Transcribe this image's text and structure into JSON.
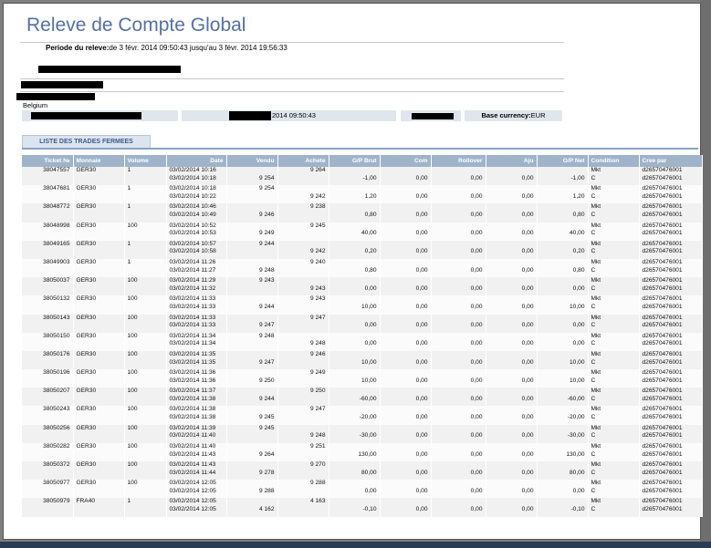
{
  "title": "Releve de Compte Global",
  "period": {
    "label": "Periode du releve:",
    "value": "de 3 févr. 2014 09:50:43 jusqu'au 3 févr. 2014 19:56:33"
  },
  "country": "Belgium",
  "info": {
    "date_suffix": "2014 09:50:43",
    "base_currency_label": "Base currency:",
    "base_currency_value": "EUR"
  },
  "tab_label": "LISTE DES TRADES FERMEES",
  "columns": [
    "Ticket №",
    "Monnaie",
    "Volume",
    "Date",
    "Vendu",
    "Achete",
    "G/P Brut",
    "Com",
    "Rollover",
    "Aju",
    "G/P Net",
    "Condition",
    "Cree par"
  ],
  "trades": [
    {
      "ticket": "38047557",
      "monnaie": "GER30",
      "volume": "1",
      "date1": "03/02/2014 10:16",
      "date2": "03/02/2014 10:18",
      "vendu": "9 254",
      "vendu_row": 2,
      "achete": "9 264",
      "achete_row": 1,
      "gp_brut": "-1,00",
      "com": "0,00",
      "rollover": "0,00",
      "aju": "0,00",
      "gp_net": "-1,00",
      "cond1": "Mkt",
      "cond2": "C",
      "cree1": "d26570476001",
      "cree2": "d26570476001"
    },
    {
      "ticket": "38047681",
      "monnaie": "GER30",
      "volume": "1",
      "date1": "03/02/2014 10:18",
      "date2": "03/02/2014 10:22",
      "vendu": "9 254",
      "vendu_row": 1,
      "achete": "9 242",
      "achete_row": 2,
      "gp_brut": "1,20",
      "com": "0,00",
      "rollover": "0,00",
      "aju": "0,00",
      "gp_net": "1,20",
      "cond1": "Mkt",
      "cond2": "C",
      "cree1": "d26570476001",
      "cree2": "d26570476001"
    },
    {
      "ticket": "38048772",
      "monnaie": "GER30",
      "volume": "1",
      "date1": "03/02/2014 10:46",
      "date2": "03/02/2014 10:49",
      "vendu": "9 246",
      "vendu_row": 2,
      "achete": "9 238",
      "achete_row": 1,
      "gp_brut": "0,80",
      "com": "0,00",
      "rollover": "0,00",
      "aju": "0,00",
      "gp_net": "0,80",
      "cond1": "Mkt",
      "cond2": "C",
      "cree1": "d26570476001",
      "cree2": "d26570476001"
    },
    {
      "ticket": "38048998",
      "monnaie": "GER30",
      "volume": "100",
      "date1": "03/02/2014 10:52",
      "date2": "03/02/2014 10:53",
      "vendu": "9 249",
      "vendu_row": 2,
      "achete": "9 245",
      "achete_row": 1,
      "gp_brut": "40,00",
      "com": "0,00",
      "rollover": "0,00",
      "aju": "0,00",
      "gp_net": "40,00",
      "cond1": "Mkt",
      "cond2": "C",
      "cree1": "d26570476001",
      "cree2": "d26570476001"
    },
    {
      "ticket": "38049165",
      "monnaie": "GER30",
      "volume": "1",
      "date1": "03/02/2014 10:57",
      "date2": "03/02/2014 10:58",
      "vendu": "9 244",
      "vendu_row": 1,
      "achete": "9 242",
      "achete_row": 2,
      "gp_brut": "0,20",
      "com": "0,00",
      "rollover": "0,00",
      "aju": "0,00",
      "gp_net": "0,20",
      "cond1": "Mkt",
      "cond2": "C",
      "cree1": "d26570476001",
      "cree2": "d26570476001"
    },
    {
      "ticket": "38049903",
      "monnaie": "GER30",
      "volume": "1",
      "date1": "03/02/2014 11:26",
      "date2": "03/02/2014 11:27",
      "vendu": "9 248",
      "vendu_row": 2,
      "achete": "9 240",
      "achete_row": 1,
      "gp_brut": "0,80",
      "com": "0,00",
      "rollover": "0,00",
      "aju": "0,00",
      "gp_net": "0,80",
      "cond1": "Mkt",
      "cond2": "C",
      "cree1": "d26570476001",
      "cree2": "d26570476001"
    },
    {
      "ticket": "38050037",
      "monnaie": "GER30",
      "volume": "100",
      "date1": "03/02/2014 11:29",
      "date2": "03/02/2014 11:32",
      "vendu": "9 243",
      "vendu_row": 1,
      "achete": "9 243",
      "achete_row": 2,
      "gp_brut": "0,00",
      "com": "0,00",
      "rollover": "0,00",
      "aju": "0,00",
      "gp_net": "0,00",
      "cond1": "Mkt",
      "cond2": "C",
      "cree1": "d26570476001",
      "cree2": "d26570476001"
    },
    {
      "ticket": "38050132",
      "monnaie": "GER30",
      "volume": "100",
      "date1": "03/02/2014 11:33",
      "date2": "03/02/2014 11:33",
      "vendu": "9 244",
      "vendu_row": 2,
      "achete": "9 243",
      "achete_row": 1,
      "gp_brut": "10,00",
      "com": "0,00",
      "rollover": "0,00",
      "aju": "0,00",
      "gp_net": "10,00",
      "cond1": "Mkt",
      "cond2": "C",
      "cree1": "d26570476001",
      "cree2": "d26570476001"
    },
    {
      "ticket": "38050143",
      "monnaie": "GER30",
      "volume": "100",
      "date1": "03/02/2014 11:33",
      "date2": "03/02/2014 11:33",
      "vendu": "9 247",
      "vendu_row": 2,
      "achete": "9 247",
      "achete_row": 1,
      "gp_brut": "0,00",
      "com": "0,00",
      "rollover": "0,00",
      "aju": "0,00",
      "gp_net": "0,00",
      "cond1": "Mkt",
      "cond2": "C",
      "cree1": "d26570476001",
      "cree2": "d26570476001"
    },
    {
      "ticket": "38050150",
      "monnaie": "GER30",
      "volume": "100",
      "date1": "03/02/2014 11:34",
      "date2": "03/02/2014 11:34",
      "vendu": "9 248",
      "vendu_row": 1,
      "achete": "9 248",
      "achete_row": 2,
      "gp_brut": "0,00",
      "com": "0,00",
      "rollover": "0,00",
      "aju": "0,00",
      "gp_net": "0,00",
      "cond1": "Mkt",
      "cond2": "C",
      "cree1": "d26570476001",
      "cree2": "d26570476001"
    },
    {
      "ticket": "38050176",
      "monnaie": "GER30",
      "volume": "100",
      "date1": "03/02/2014 11:35",
      "date2": "03/02/2014 11:35",
      "vendu": "9 247",
      "vendu_row": 2,
      "achete": "9 246",
      "achete_row": 1,
      "gp_brut": "10,00",
      "com": "0,00",
      "rollover": "0,00",
      "aju": "0,00",
      "gp_net": "10,00",
      "cond1": "Mkt",
      "cond2": "C",
      "cree1": "d26570476001",
      "cree2": "d26570476001"
    },
    {
      "ticket": "38050196",
      "monnaie": "GER30",
      "volume": "100",
      "date1": "03/02/2014 11:36",
      "date2": "03/02/2014 11:36",
      "vendu": "9 250",
      "vendu_row": 2,
      "achete": "9 249",
      "achete_row": 1,
      "gp_brut": "10,00",
      "com": "0,00",
      "rollover": "0,00",
      "aju": "0,00",
      "gp_net": "10,00",
      "cond1": "Mkt",
      "cond2": "C",
      "cree1": "d26570476001",
      "cree2": "d26570476001"
    },
    {
      "ticket": "38050207",
      "monnaie": "GER30",
      "volume": "100",
      "date1": "03/02/2014 11:37",
      "date2": "03/02/2014 11:38",
      "vendu": "9 244",
      "vendu_row": 2,
      "achete": "9 250",
      "achete_row": 1,
      "gp_brut": "-60,00",
      "com": "0,00",
      "rollover": "0,00",
      "aju": "0,00",
      "gp_net": "-60,00",
      "cond1": "Mkt",
      "cond2": "C",
      "cree1": "d26570476001",
      "cree2": "d26570476001"
    },
    {
      "ticket": "38050243",
      "monnaie": "GER30",
      "volume": "100",
      "date1": "03/02/2014 11:38",
      "date2": "03/02/2014 11:38",
      "vendu": "9 245",
      "vendu_row": 2,
      "achete": "9 247",
      "achete_row": 1,
      "gp_brut": "-20,00",
      "com": "0,00",
      "rollover": "0,00",
      "aju": "0,00",
      "gp_net": "-20,00",
      "cond1": "Mkt",
      "cond2": "C",
      "cree1": "d26570476001",
      "cree2": "d26570476001"
    },
    {
      "ticket": "38050256",
      "monnaie": "GER30",
      "volume": "100",
      "date1": "03/02/2014 11:39",
      "date2": "03/02/2014 11:40",
      "vendu": "9 245",
      "vendu_row": 1,
      "achete": "9 248",
      "achete_row": 2,
      "gp_brut": "-30,00",
      "com": "0,00",
      "rollover": "0,00",
      "aju": "0,00",
      "gp_net": "-30,00",
      "cond1": "Mkt",
      "cond2": "C",
      "cree1": "d26570476001",
      "cree2": "d26570476001"
    },
    {
      "ticket": "38050282",
      "monnaie": "GER30",
      "volume": "100",
      "date1": "03/02/2014 11:40",
      "date2": "03/02/2014 11:43",
      "vendu": "9 264",
      "vendu_row": 2,
      "achete": "9 251",
      "achete_row": 1,
      "gp_brut": "130,00",
      "com": "0,00",
      "rollover": "0,00",
      "aju": "0,00",
      "gp_net": "130,00",
      "cond1": "Mkt",
      "cond2": "C",
      "cree1": "d26570476001",
      "cree2": "d26570476001"
    },
    {
      "ticket": "38050372",
      "monnaie": "GER30",
      "volume": "100",
      "date1": "03/02/2014 11:43",
      "date2": "03/02/2014 11:44",
      "vendu": "9 278",
      "vendu_row": 2,
      "achete": "9 270",
      "achete_row": 1,
      "gp_brut": "80,00",
      "com": "0,00",
      "rollover": "0,00",
      "aju": "0,00",
      "gp_net": "80,00",
      "cond1": "Mkt",
      "cond2": "C",
      "cree1": "d26570476001",
      "cree2": "d26570476001"
    },
    {
      "ticket": "38050977",
      "monnaie": "GER30",
      "volume": "100",
      "date1": "03/02/2014 12:05",
      "date2": "03/02/2014 12:05",
      "vendu": "9 288",
      "vendu_row": 2,
      "achete": "9 288",
      "achete_row": 1,
      "gp_brut": "0,00",
      "com": "0,00",
      "rollover": "0,00",
      "aju": "0,00",
      "gp_net": "0,00",
      "cond1": "Mkt",
      "cond2": "C",
      "cree1": "d26570476001",
      "cree2": "d26570476001"
    },
    {
      "ticket": "38050979",
      "monnaie": "FRA40",
      "volume": "1",
      "date1": "03/02/2014 12:05",
      "date2": "03/02/2014 12:05",
      "vendu": "4 162",
      "vendu_row": 2,
      "achete": "4 163",
      "achete_row": 1,
      "gp_brut": "-0,10",
      "com": "0,00",
      "rollover": "0,00",
      "aju": "0,00",
      "gp_net": "-0,10",
      "cond1": "Mkt",
      "cond2": "C",
      "cree1": "d26570476001",
      "cree2": "d26570476001"
    }
  ]
}
